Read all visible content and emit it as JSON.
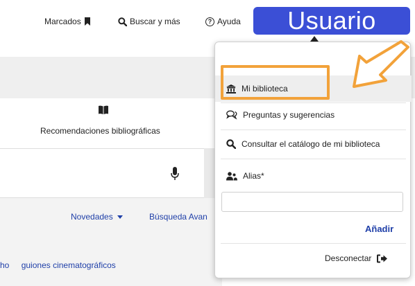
{
  "nav": {
    "bookmarks_label": "Marcados",
    "search_label": "Buscar y más",
    "help_label": "Ayuda",
    "user_label": "Usuario"
  },
  "page": {
    "recommendations_label": "Recomendaciones bibliográficas",
    "menu": {
      "novedades_label": "Novedades",
      "busqueda_label": "Búsqueda Avan"
    },
    "tags": [
      "ho",
      "guiones cinematográficos"
    ]
  },
  "dropdown": {
    "items": [
      {
        "label": "Mi biblioteca",
        "icon": "library-icon"
      },
      {
        "label": "Preguntas y sugerencias",
        "icon": "chat-icon"
      },
      {
        "label": "Consultar el catálogo de mi biblioteca",
        "icon": "search-icon"
      },
      {
        "label": "Alias*",
        "icon": "users-icon"
      }
    ],
    "add_label": "Añadir",
    "logout_label": "Desconectar"
  },
  "colors": {
    "user_button": "#3b4fd6",
    "highlight": "#f2a23a",
    "link": "#1f3fa8"
  }
}
